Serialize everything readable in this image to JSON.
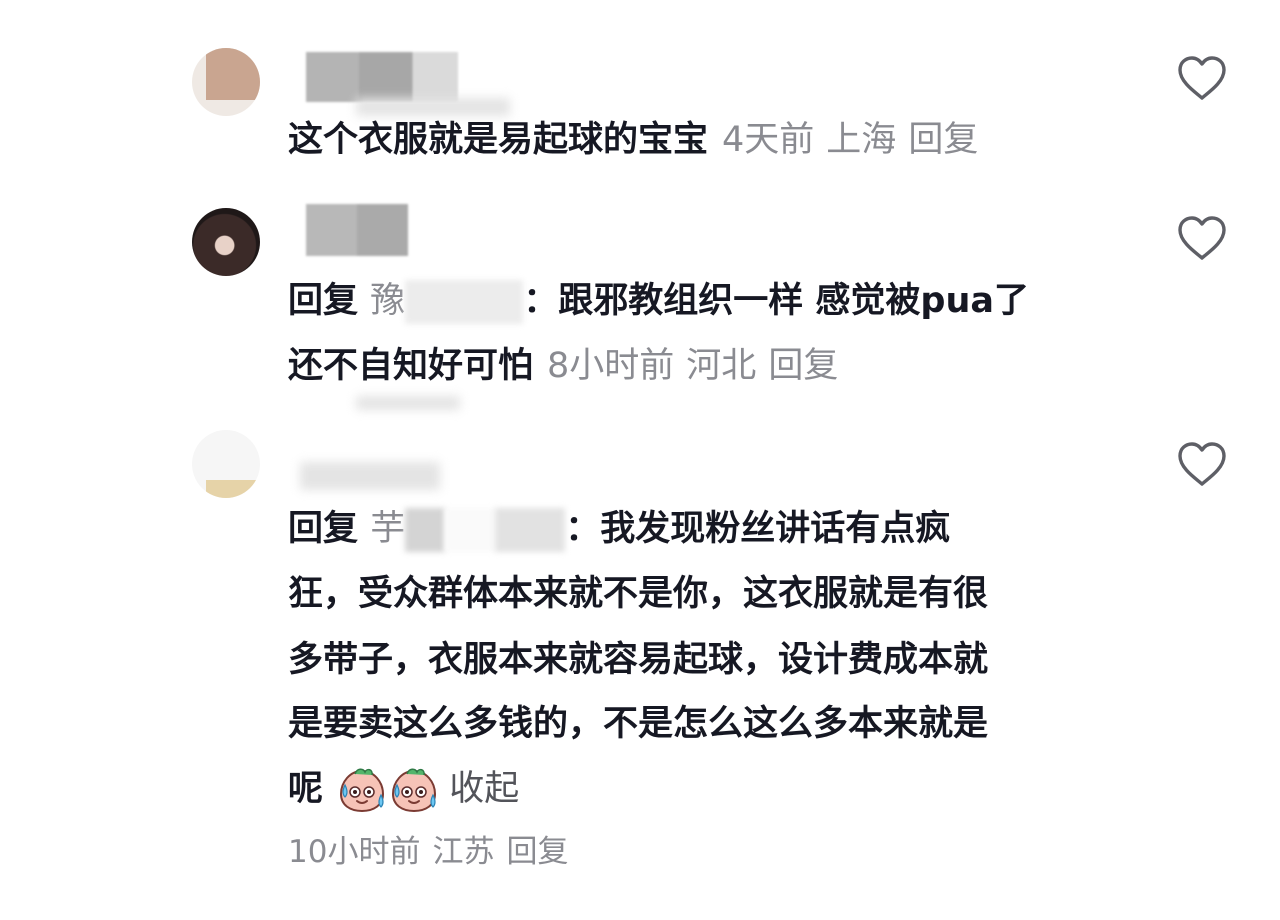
{
  "comments": [
    {
      "text": "这个衣服就是易起球的宝宝",
      "time": "4天前",
      "location": "上海",
      "reply_label": "回复"
    },
    {
      "reply_prefix": "回复",
      "reply_target_start": "豫",
      "reply_target_end": "：",
      "text_line1": "跟邪教组织一样 感觉被pua了",
      "text_line2": "还不自知好可怕",
      "time": "8小时前",
      "location": "河北",
      "reply_label": "回复"
    },
    {
      "reply_prefix": "回复",
      "reply_target_start": "芋",
      "reply_target_end": "：",
      "text_lines": [
        "我发现粉丝讲话有点疯",
        "狂，受众群体本来就不是你，这衣服就是有很",
        "多带子，衣服本来就容易起球，设计费成本就",
        "是要卖这么多钱的，不是怎么这么多本来就是",
        "呢"
      ],
      "collapse_label": "收起",
      "time": "10小时前",
      "location": "江苏",
      "reply_label": "回复"
    }
  ],
  "icons": {
    "like": "heart-outline-icon",
    "emoji": "sweat-face-emoji-icon"
  },
  "colors": {
    "text": "#161823",
    "meta": "#8a8b91",
    "background": "#ffffff"
  }
}
